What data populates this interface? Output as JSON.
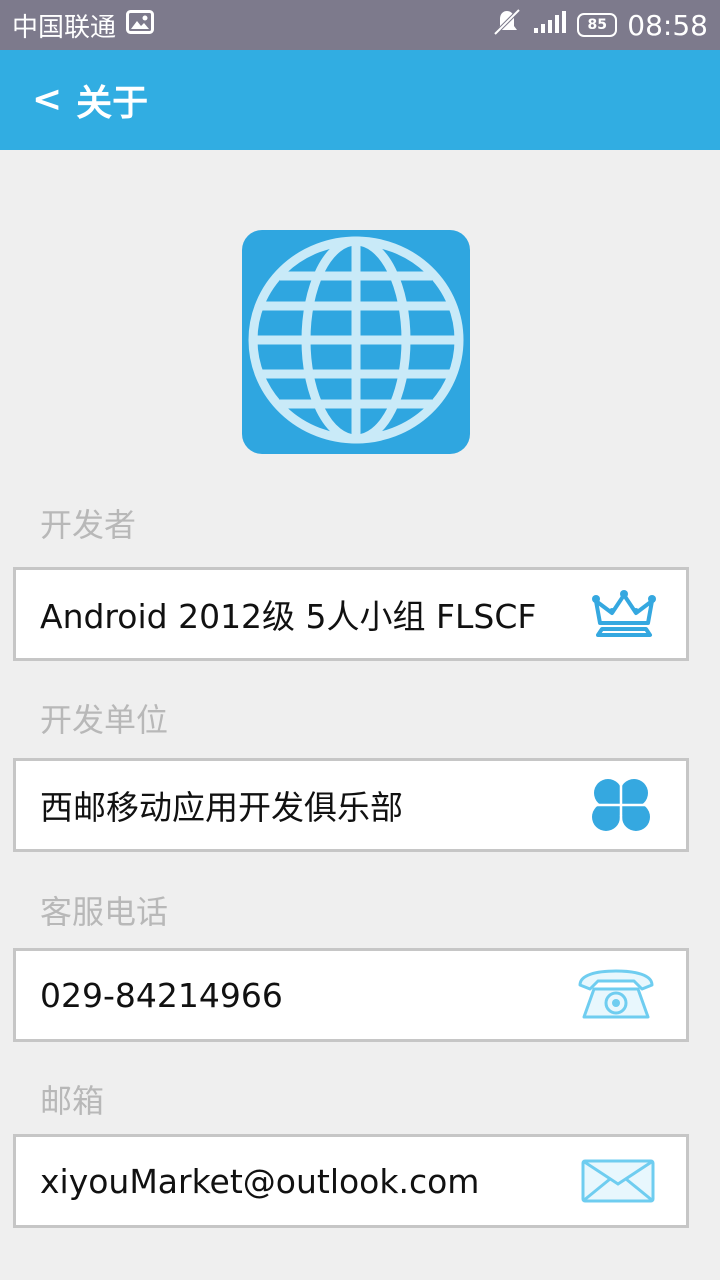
{
  "status_bar": {
    "carrier": "中国联通",
    "battery": "85",
    "time": "08:58"
  },
  "app_bar": {
    "back_glyph": "<",
    "title": "关于"
  },
  "sections": [
    {
      "label": "开发者",
      "value": "Android 2012级 5人小组 FLSCF",
      "icon": "crown-icon"
    },
    {
      "label": "开发单位",
      "value": "西邮移动应用开发俱乐部",
      "icon": "clover-icon"
    },
    {
      "label": "客服电话",
      "value": "029-84214966",
      "icon": "telephone-icon"
    },
    {
      "label": "邮箱",
      "value": "xiyouMarket@outlook.com",
      "icon": "envelope-icon"
    }
  ],
  "colors": {
    "status_bar": "#7d7a8c",
    "app_bar": "#31ade2",
    "logo_bg": "#2fa6e0",
    "icon_accent": "#35a8e0",
    "background": "#efefef"
  }
}
